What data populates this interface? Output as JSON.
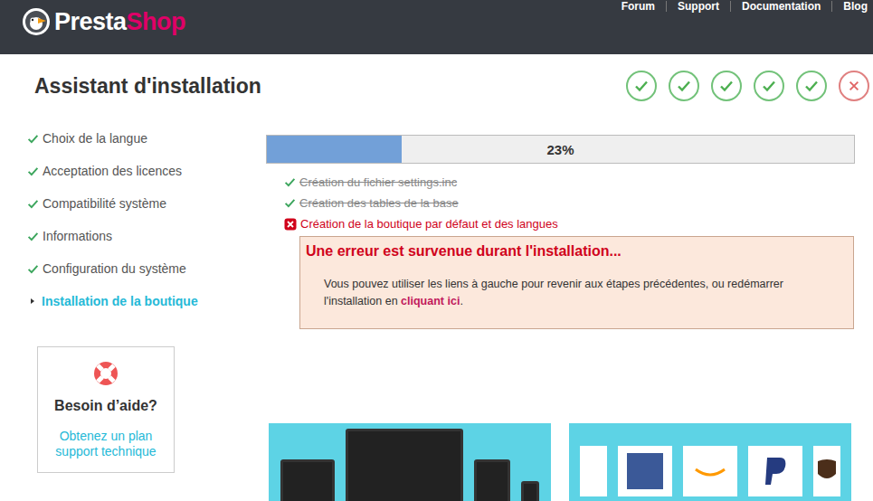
{
  "header": {
    "logo": {
      "first": "Presta",
      "second": "Shop"
    },
    "nav": [
      "Forum",
      "Support",
      "Documentation",
      "Blog"
    ]
  },
  "title": "Assistant d'installation",
  "steps": [
    {
      "status": "done"
    },
    {
      "status": "done"
    },
    {
      "status": "done"
    },
    {
      "status": "done"
    },
    {
      "status": "done"
    },
    {
      "status": "error"
    }
  ],
  "sidebar": {
    "items": [
      {
        "label": "Choix de la langue",
        "done": true,
        "selected": false
      },
      {
        "label": "Acceptation des licences",
        "done": true,
        "selected": false
      },
      {
        "label": "Compatibilité système",
        "done": true,
        "selected": false
      },
      {
        "label": "Informations",
        "done": true,
        "selected": false
      },
      {
        "label": "Configuration du système",
        "done": true,
        "selected": false
      },
      {
        "label": "Installation de la boutique",
        "done": false,
        "selected": true
      }
    ]
  },
  "help": {
    "title": "Besoin d’aide?",
    "link": "Obtenez un plan support technique"
  },
  "progress": {
    "level": 0.23,
    "reading": "23%"
  },
  "tasks": [
    {
      "label": "Création du fichier settings.inc",
      "status": "done"
    },
    {
      "label": "Création des tables de la base",
      "status": "done"
    },
    {
      "label": "Création de la boutique par défaut et des langues",
      "status": "error"
    }
  ],
  "error": {
    "title": "Une erreur est survenue durant l'installation...",
    "before": "Vous pouvez utiliser les liens à gauche pour revenir aux étapes précédentes, ou redémarrer l'installation en ",
    "link": "cliquant ici",
    "after": "."
  },
  "banners": [
    {
      "kind": "devices"
    },
    {
      "kind": "partners"
    }
  ]
}
